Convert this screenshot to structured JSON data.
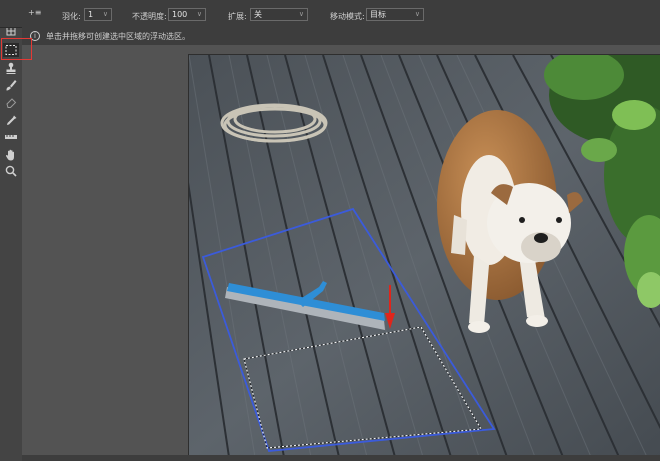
{
  "options_bar": {
    "mode_icon_label": "+≡",
    "feather_label": "羽化:",
    "feather_value": "1",
    "opacity_label": "不透明度:",
    "opacity_value": "100",
    "diffuse_label": "扩展:",
    "diffuse_value": "关",
    "move_mode_label": "移动模式:",
    "move_mode_value": "目标"
  },
  "hint": {
    "icon": "i",
    "text": "单击并拖移可创建选中区域的浮动选区。"
  },
  "tools": [
    {
      "name": "move-tool",
      "icon": "arrow-icon"
    },
    {
      "name": "artboard-tool",
      "icon": "artboard-icon"
    },
    {
      "name": "marquee-tool",
      "icon": "marquee-icon",
      "active": true
    },
    {
      "name": "stamp-tool",
      "icon": "stamp-icon"
    },
    {
      "name": "brush-tool",
      "icon": "brush-icon"
    },
    {
      "name": "eraser-tool",
      "icon": "eraser-icon"
    },
    {
      "name": "eyedropper-tool",
      "icon": "eyedropper-icon"
    },
    {
      "name": "ruler-tool",
      "icon": "ruler-icon"
    },
    {
      "name": "hand-tool",
      "icon": "hand-icon"
    },
    {
      "name": "zoom-tool",
      "icon": "zoom-icon"
    }
  ],
  "colors": {
    "selection_blue": "#3b5bdb",
    "highlight_red": "#e53935",
    "arrow_red": "#e0251b"
  }
}
